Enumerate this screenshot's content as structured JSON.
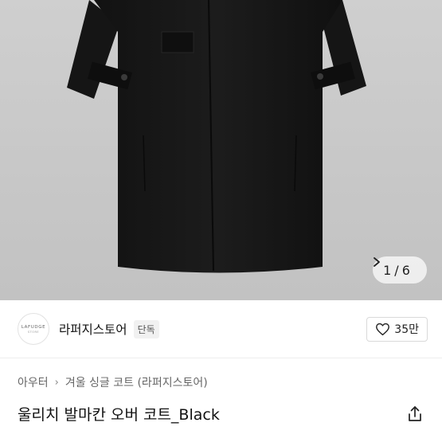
{
  "gallery": {
    "current": "1",
    "divider": "/",
    "total": "6",
    "next_icon": "chevron-right-icon"
  },
  "store": {
    "logo_text": "LAFUDGE",
    "logo_sub": "STORE",
    "name": "라퍼지스토어",
    "badge": "단독",
    "follow_icon": "heart-icon",
    "follow_count": "35만"
  },
  "breadcrumb": {
    "items": [
      "아우터",
      "겨울 싱글 코트 (라퍼지스토어)"
    ],
    "separator": "›"
  },
  "product": {
    "title": "울리치 발마칸 오버 코트_Black",
    "share_icon": "share-icon"
  }
}
